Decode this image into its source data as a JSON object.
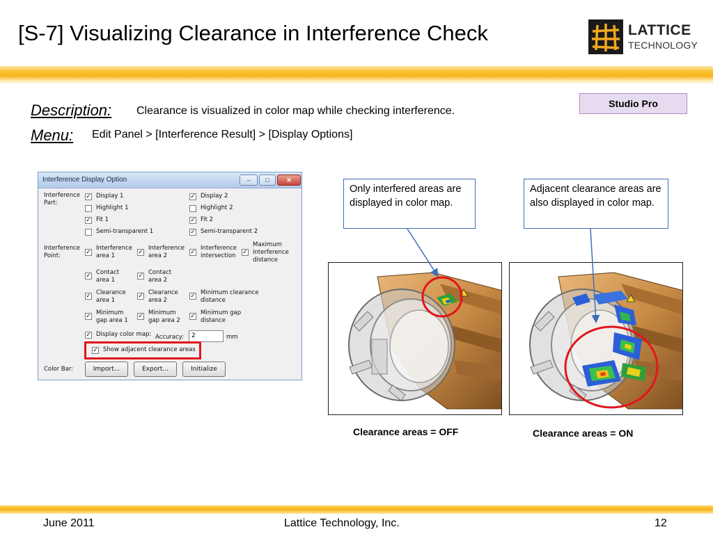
{
  "slide": {
    "title": "[S-7] Visualizing Clearance in Interference Check",
    "logo_line1": "LATTICE",
    "logo_line2": "TECHNOLOGY",
    "badge": "Studio Pro",
    "description_label": "Description:",
    "description_text": "Clearance is visualized in color map while checking interference.",
    "menu_label": "Menu:",
    "menu_text": "Edit Panel > [Interference Result] > [Display Options]"
  },
  "dialog": {
    "title": "Interference Display Option",
    "window_buttons": [
      "–",
      "□",
      "✕"
    ],
    "groups": {
      "interference_part": "Interference Part:",
      "interference_point": "Interference Point:",
      "color_bar": "Color Bar:"
    },
    "checkboxes": {
      "display1": {
        "label": "Display 1",
        "checked": true
      },
      "highlight1": {
        "label": "Highlight 1",
        "checked": false
      },
      "fit1": {
        "label": "Fit 1",
        "checked": true
      },
      "semi1": {
        "label": "Semi-transparent 1",
        "checked": false
      },
      "display2": {
        "label": "Display 2",
        "checked": true
      },
      "highlight2": {
        "label": "Highlight 2",
        "checked": false
      },
      "fit2": {
        "label": "Fit 2",
        "checked": true
      },
      "semi2": {
        "label": "Semi-transparent 2",
        "checked": true
      },
      "ia1": {
        "label": "Interference area 1",
        "checked": true
      },
      "ia2": {
        "label": "Interference area 2",
        "checked": true
      },
      "iint": {
        "label": "Interference intersection",
        "checked": true
      },
      "maxid": {
        "label": "Maximum interference distance",
        "checked": true
      },
      "ca1": {
        "label": "Contact area 1",
        "checked": true
      },
      "ca2": {
        "label": "Contact area 2",
        "checked": true
      },
      "cla1": {
        "label": "Clearance area 1",
        "checked": true
      },
      "cla2": {
        "label": "Clearance area 2",
        "checked": true
      },
      "mincd": {
        "label": "Minimum clearance distance",
        "checked": true
      },
      "mga1": {
        "label": "Minimum gap area 1",
        "checked": true
      },
      "mga2": {
        "label": "Minimum gap area 2",
        "checked": true
      },
      "mgd": {
        "label": "Minimum gap distance",
        "checked": true
      },
      "dcm": {
        "label": "Display color map:",
        "checked": true
      },
      "sac": {
        "label": "Show adjacent clearance areas",
        "checked": true
      }
    },
    "accuracy_label": "Accuracy:",
    "accuracy_value": "2",
    "accuracy_unit": "mm",
    "buttons": {
      "import": "Import...",
      "export": "Export...",
      "initialize": "Initialize"
    }
  },
  "callouts": {
    "left": "Only interfered areas are displayed in color map.",
    "right": "Adjacent clearance areas are also displayed in color map."
  },
  "captions": {
    "left": "Clearance areas = OFF",
    "right": "Clearance areas = ON"
  },
  "footer": {
    "date": "June 2011",
    "company": "Lattice Technology, Inc.",
    "page": "12"
  },
  "colors": {
    "accent_band": "#f7b31a",
    "highlight_red": "#e2151b",
    "callout_border": "#3f6eb5",
    "badge_bg": "#e7dcef",
    "model_bronze": "#c98b45"
  }
}
